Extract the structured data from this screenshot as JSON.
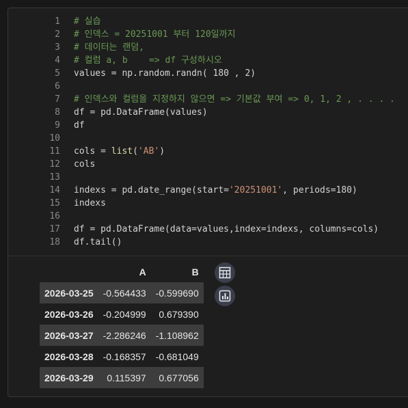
{
  "code": {
    "lines": [
      {
        "n": "1",
        "parts": [
          {
            "t": "# 실습",
            "k": "c"
          }
        ]
      },
      {
        "n": "2",
        "parts": [
          {
            "t": "# 인덱스 = 20251001 부터 120일까지",
            "k": "c"
          }
        ]
      },
      {
        "n": "3",
        "parts": [
          {
            "t": "# 데이터는 랜덤,",
            "k": "c"
          }
        ]
      },
      {
        "n": "4",
        "parts": [
          {
            "t": "# 컬럼 a, b    => df 구성하시오",
            "k": "c"
          }
        ]
      },
      {
        "n": "5",
        "parts": [
          {
            "t": "values = np.random.randn( 180 , 2)",
            "k": ""
          }
        ]
      },
      {
        "n": "6",
        "parts": []
      },
      {
        "n": "7",
        "parts": [
          {
            "t": "# 인덱스와 컬럼을 지정하지 않으면 => 기본값 부여 => 0, 1, 2 , . . . .",
            "k": "c"
          }
        ]
      },
      {
        "n": "8",
        "parts": [
          {
            "t": "df = pd.DataFrame(values)",
            "k": ""
          }
        ]
      },
      {
        "n": "9",
        "parts": [
          {
            "t": "df",
            "k": ""
          }
        ]
      },
      {
        "n": "10",
        "parts": []
      },
      {
        "n": "11",
        "parts": [
          {
            "t": "cols = ",
            "k": ""
          },
          {
            "t": "list",
            "k": "f"
          },
          {
            "t": "(",
            "k": ""
          },
          {
            "t": "'AB'",
            "k": "s"
          },
          {
            "t": ")",
            "k": ""
          }
        ]
      },
      {
        "n": "12",
        "parts": [
          {
            "t": "cols",
            "k": ""
          }
        ]
      },
      {
        "n": "13",
        "parts": []
      },
      {
        "n": "14",
        "parts": [
          {
            "t": "indexs = pd.date_range(start=",
            "k": ""
          },
          {
            "t": "'20251001'",
            "k": "s"
          },
          {
            "t": ", periods=180)",
            "k": ""
          }
        ]
      },
      {
        "n": "15",
        "parts": [
          {
            "t": "indexs",
            "k": ""
          }
        ]
      },
      {
        "n": "16",
        "parts": []
      },
      {
        "n": "17",
        "parts": [
          {
            "t": "df = pd.DataFrame(data=values,index=indexs, columns=cols)",
            "k": ""
          }
        ]
      },
      {
        "n": "18",
        "parts": [
          {
            "t": "df.tail()",
            "k": ""
          }
        ]
      }
    ]
  },
  "output": {
    "columns": [
      "",
      "A",
      "B"
    ],
    "rows": [
      {
        "index": "2026-03-25",
        "A": "-0.564433",
        "B": "-0.599690"
      },
      {
        "index": "2026-03-26",
        "A": "-0.204999",
        "B": "0.679390"
      },
      {
        "index": "2026-03-27",
        "A": "-2.286246",
        "B": "-1.108962"
      },
      {
        "index": "2026-03-28",
        "A": "-0.168357",
        "B": "-0.681049"
      },
      {
        "index": "2026-03-29",
        "A": "0.115397",
        "B": "0.677056"
      }
    ]
  },
  "buttons": {
    "table_icon": "table-icon",
    "chart_icon": "bar-chart-icon"
  }
}
